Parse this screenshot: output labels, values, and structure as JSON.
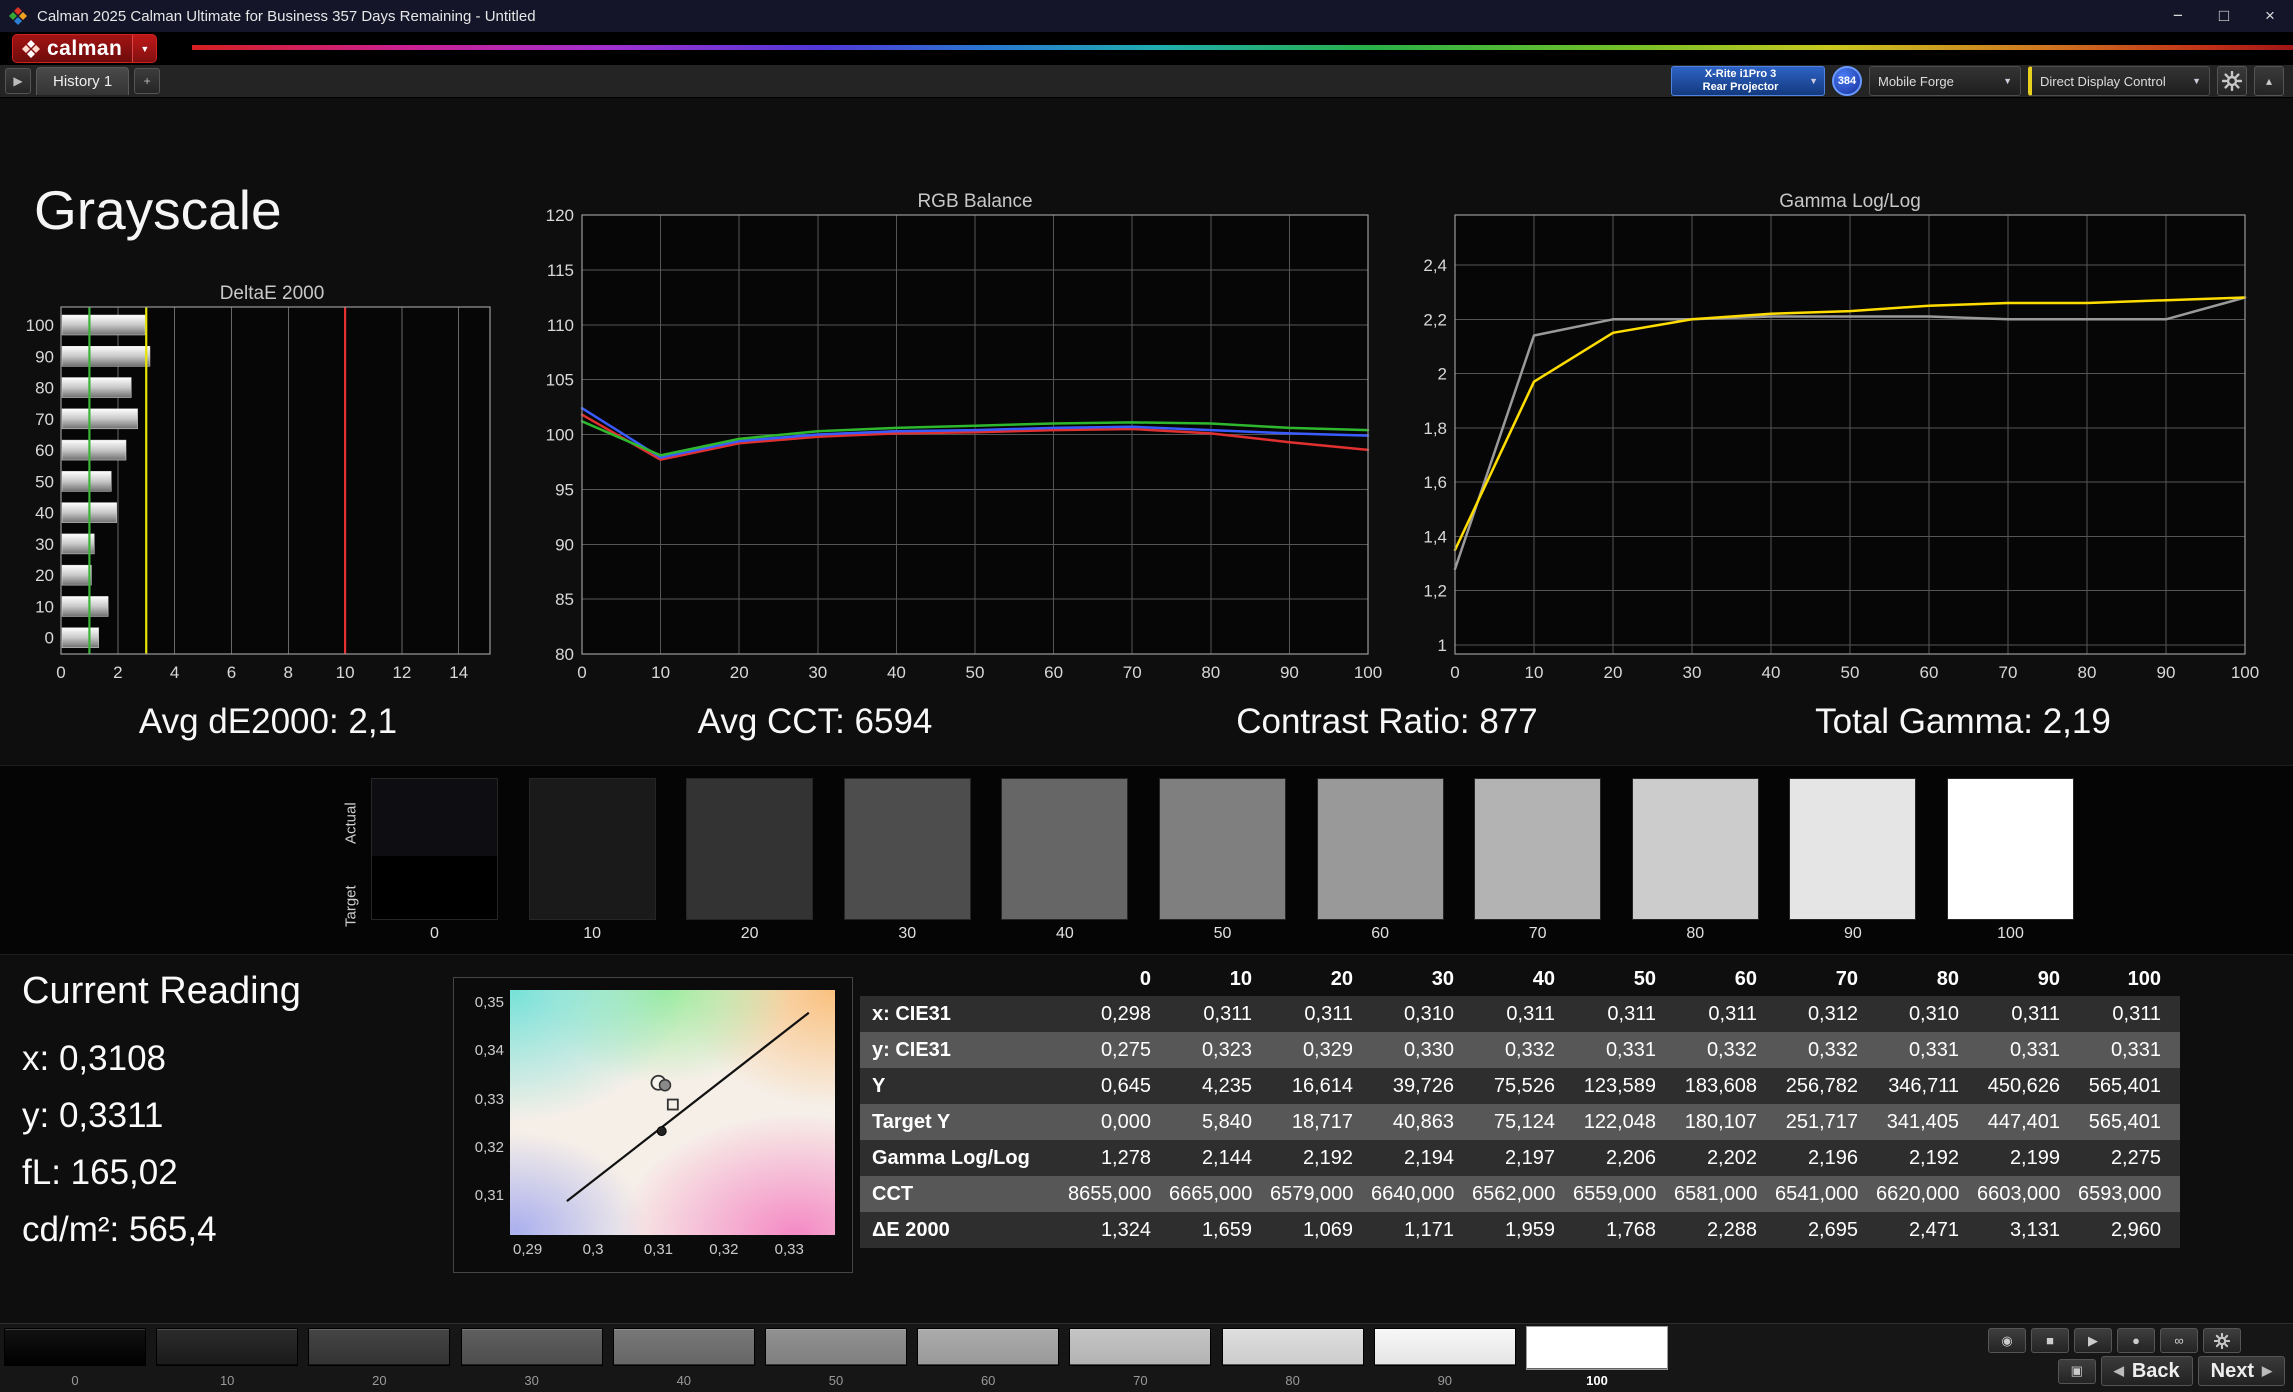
{
  "window": {
    "title": "Calman 2025 Calman Ultimate for Business 357 Days Remaining  - Untitled"
  },
  "brand": {
    "name": "calman"
  },
  "icons": {
    "minimize": "−",
    "maximize": "□",
    "close": "×",
    "dropdown": "▼",
    "history_arrow": "▶",
    "add_tab": "+",
    "cam": "◉",
    "stop": "■",
    "play": "▶",
    "record": "●",
    "loop": "∞",
    "pattern": "▣",
    "panel_toggle": "▴",
    "back_arrow": "◀",
    "next_arrow": "▶"
  },
  "toolbar": {
    "history_tab": "History 1",
    "meter_line1": "X-Rite i1Pro 3",
    "meter_line2": "Rear Projector",
    "meter_badge": "384",
    "source_label": "Mobile Forge",
    "display_control_label": "Direct Display Control"
  },
  "page": {
    "heading": "Grayscale",
    "stats": [
      "Avg dE2000: 2,1",
      "Avg CCT: 6594",
      "Contrast Ratio: 877",
      "Total Gamma: 2,19"
    ]
  },
  "swatch_row": {
    "actual_label": "Actual",
    "target_label": "Target",
    "levels": [
      0,
      10,
      20,
      30,
      40,
      50,
      60,
      70,
      80,
      90,
      100
    ]
  },
  "current_reading": {
    "title": "Current Reading",
    "lines": [
      "x: 0,3108",
      "y: 0,3311",
      "fL: 165,02",
      "cd/m²: 565,4"
    ]
  },
  "table": {
    "columns": [
      "0",
      "10",
      "20",
      "30",
      "40",
      "50",
      "60",
      "70",
      "80",
      "90",
      "100"
    ],
    "rows": [
      {
        "label": "x: CIE31",
        "values": [
          "0,298",
          "0,311",
          "0,311",
          "0,310",
          "0,311",
          "0,311",
          "0,311",
          "0,312",
          "0,310",
          "0,311",
          "0,311"
        ]
      },
      {
        "label": "y: CIE31",
        "values": [
          "0,275",
          "0,323",
          "0,329",
          "0,330",
          "0,332",
          "0,331",
          "0,332",
          "0,332",
          "0,331",
          "0,331",
          "0,331"
        ]
      },
      {
        "label": "Y",
        "values": [
          "0,645",
          "4,235",
          "16,614",
          "39,726",
          "75,526",
          "123,589",
          "183,608",
          "256,782",
          "346,711",
          "450,626",
          "565,401"
        ]
      },
      {
        "label": "Target Y",
        "values": [
          "0,000",
          "5,840",
          "18,717",
          "40,863",
          "75,124",
          "122,048",
          "180,107",
          "251,717",
          "341,405",
          "447,401",
          "565,401"
        ]
      },
      {
        "label": "Gamma Log/Log",
        "values": [
          "1,278",
          "2,144",
          "2,192",
          "2,194",
          "2,197",
          "2,206",
          "2,202",
          "2,196",
          "2,192",
          "2,199",
          "2,275"
        ]
      },
      {
        "label": "CCT",
        "values": [
          "8655,000",
          "6665,000",
          "6579,000",
          "6640,000",
          "6562,000",
          "6559,000",
          "6581,000",
          "6541,000",
          "6620,000",
          "6603,000",
          "6593,000"
        ]
      },
      {
        "label": "ΔE 2000",
        "values": [
          "1,324",
          "1,659",
          "1,069",
          "1,171",
          "1,959",
          "1,768",
          "2,288",
          "2,695",
          "2,471",
          "3,131",
          "2,960"
        ]
      }
    ]
  },
  "bottom_bar": {
    "levels": [
      0,
      10,
      20,
      30,
      40,
      50,
      60,
      70,
      80,
      90,
      100
    ],
    "selected_level": 100,
    "back_label": "Back",
    "next_label": "Next"
  },
  "chart_data": [
    {
      "id": "deltae",
      "type": "bar",
      "title": "DeltaE 2000",
      "orientation": "horizontal",
      "categories": [
        100,
        90,
        80,
        70,
        60,
        50,
        40,
        30,
        20,
        10,
        0
      ],
      "values": [
        2.96,
        3.131,
        2.471,
        2.695,
        2.288,
        1.768,
        1.959,
        1.171,
        1.069,
        1.659,
        1.324
      ],
      "xlim": [
        0,
        15.1
      ],
      "xticks": [
        0,
        2,
        4,
        6,
        8,
        10,
        12,
        14
      ],
      "ref_lines": [
        {
          "value": 1,
          "color": "#3cb43c"
        },
        {
          "value": 3,
          "color": "#e6e600"
        },
        {
          "value": 10,
          "color": "#e53030"
        }
      ]
    },
    {
      "id": "rgb-balance",
      "type": "line",
      "title": "RGB Balance",
      "x": [
        0,
        10,
        20,
        30,
        40,
        50,
        60,
        70,
        80,
        90,
        100
      ],
      "xlim": [
        0,
        100
      ],
      "xticks": [
        0,
        10,
        20,
        30,
        40,
        50,
        60,
        70,
        80,
        90,
        100
      ],
      "ylim": [
        80,
        120
      ],
      "yticks": [
        80,
        85,
        90,
        95,
        100,
        105,
        110,
        115,
        120
      ],
      "series": [
        {
          "name": "Red",
          "color": "#e03030",
          "values": [
            101.8,
            97.7,
            99.2,
            99.8,
            100.1,
            100.2,
            100.4,
            100.5,
            100.1,
            99.3,
            98.6
          ]
        },
        {
          "name": "Blue",
          "color": "#3a5cff",
          "values": [
            102.4,
            97.9,
            99.4,
            100.0,
            100.3,
            100.4,
            100.6,
            100.7,
            100.4,
            100.1,
            99.9
          ]
        },
        {
          "name": "Green",
          "color": "#2eb82e",
          "values": [
            101.2,
            98.1,
            99.6,
            100.3,
            100.6,
            100.8,
            101.0,
            101.1,
            101.0,
            100.6,
            100.4
          ]
        }
      ]
    },
    {
      "id": "gamma-loglog",
      "type": "line",
      "title": "Gamma Log/Log",
      "x": [
        0,
        10,
        20,
        30,
        40,
        50,
        60,
        70,
        80,
        90,
        100
      ],
      "xlim": [
        0,
        100
      ],
      "xticks": [
        0,
        10,
        20,
        30,
        40,
        50,
        60,
        70,
        80,
        90,
        100
      ],
      "ylim": [
        0.967,
        2.584
      ],
      "yticks": [
        1,
        1.2,
        1.4,
        1.6,
        1.8,
        2,
        2.2,
        2.4
      ],
      "ytick_labels": [
        "1",
        "1,2",
        "1,4",
        "1,6",
        "1,8",
        "2",
        "2,2",
        "2,4"
      ],
      "series": [
        {
          "name": "Target",
          "color": "#9a9a9a",
          "values": [
            1.28,
            2.14,
            2.2,
            2.2,
            2.21,
            2.21,
            2.21,
            2.2,
            2.2,
            2.2,
            2.28
          ]
        },
        {
          "name": "Measured",
          "color": "#ffdd00",
          "values": [
            1.35,
            1.97,
            2.15,
            2.2,
            2.22,
            2.23,
            2.25,
            2.26,
            2.26,
            2.27,
            2.28
          ]
        }
      ]
    },
    {
      "id": "cie-detail",
      "type": "scatter",
      "xlim": [
        0.2873,
        0.337
      ],
      "ylim": [
        0.302,
        0.3527
      ],
      "xticks": [
        0.29,
        0.3,
        0.31,
        0.32,
        0.33
      ],
      "xtick_labels": [
        "0,29",
        "0,3",
        "0,31",
        "0,32",
        "0,33"
      ],
      "yticks": [
        0.35,
        0.34,
        0.33,
        0.32,
        0.31
      ],
      "ytick_labels": [
        "0,35",
        "0,34",
        "0,33",
        "0,32",
        "0,31"
      ],
      "locus_line": {
        "x1": 0.296,
        "y1": 0.309,
        "x2": 0.333,
        "y2": 0.348
      },
      "points": [
        {
          "x": 0.31,
          "y": 0.3335,
          "marker": "open-circle"
        },
        {
          "x": 0.311,
          "y": 0.333,
          "marker": "filled-circle"
        },
        {
          "x": 0.3122,
          "y": 0.329,
          "marker": "open-square"
        },
        {
          "x": 0.3105,
          "y": 0.3235,
          "marker": "filled-dot"
        }
      ]
    }
  ]
}
